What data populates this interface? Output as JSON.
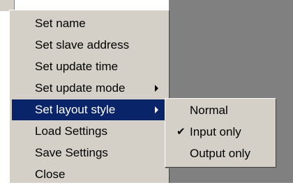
{
  "menu": {
    "items": [
      {
        "label": "Set name"
      },
      {
        "label": "Set slave address"
      },
      {
        "label": "Set update time"
      },
      {
        "label": "Set update mode"
      },
      {
        "label": "Set layout style"
      },
      {
        "label": "Load Settings"
      },
      {
        "label": "Save Settings"
      },
      {
        "label": "Close"
      }
    ]
  },
  "submenu": {
    "items": [
      {
        "label": "Normal"
      },
      {
        "label": "Input only",
        "checked": true
      },
      {
        "label": "Output only"
      }
    ],
    "check_glyph": "✔"
  },
  "colors": {
    "highlight": "#0a246a",
    "menu_bg": "#d4d0c8",
    "desktop_bg": "#808080"
  }
}
